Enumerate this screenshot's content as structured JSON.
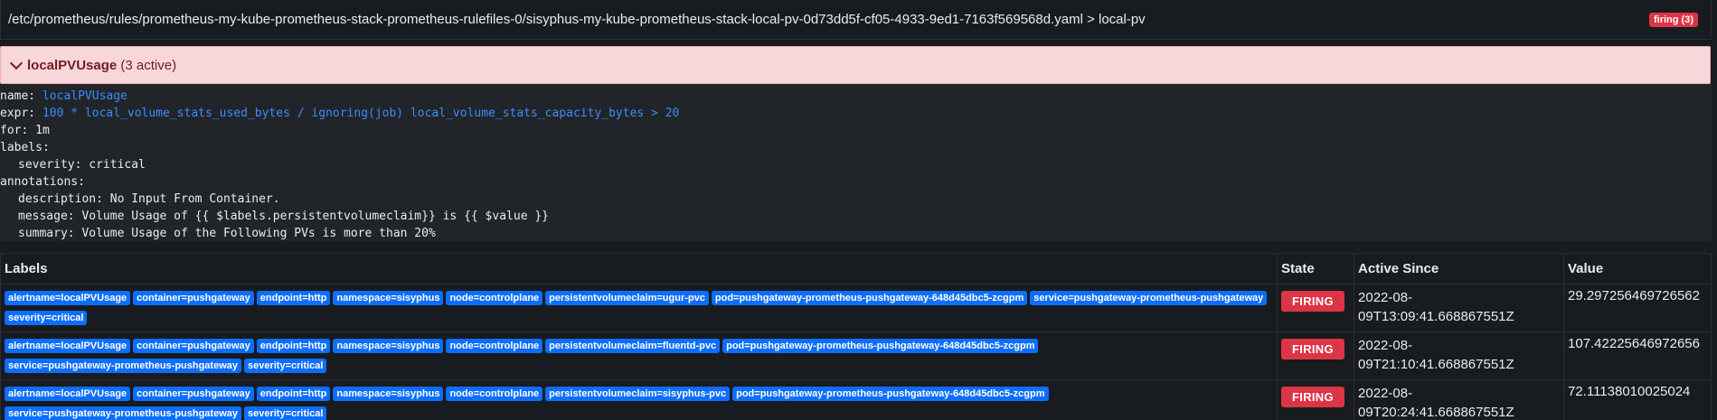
{
  "file": {
    "path": "/etc/prometheus/rules/prometheus-my-kube-prometheus-stack-prometheus-rulefiles-0/sisyphus-my-kube-prometheus-stack-local-pv-0d73dd5f-cf05-4933-9ed1-7163f569568d.yaml > local-pv",
    "badge": "firing (3)"
  },
  "rule": {
    "name": "localPVUsage",
    "active_count": "(3 active)",
    "lines": {
      "name_key": "name: ",
      "name_val": "localPVUsage",
      "expr_key": "expr: ",
      "expr_val": "100 * local_volume_stats_used_bytes / ignoring(job) local_volume_stats_capacity_bytes > 20",
      "for": "for: 1m",
      "labels": "labels:",
      "severity": "severity: critical",
      "annotations": "annotations:",
      "description": "description: No Input From Container.",
      "message": "message: Volume Usage of {{ $labels.persistentvolumeclaim}} is {{ $value }}",
      "summary": "summary: Volume Usage of the Following PVs is more than 20%"
    }
  },
  "table": {
    "headers": {
      "labels": "Labels",
      "state": "State",
      "active_since": "Active Since",
      "value": "Value"
    },
    "rows": [
      {
        "labels": [
          "alertname=localPVUsage",
          "container=pushgateway",
          "endpoint=http",
          "namespace=sisyphus",
          "node=controlplane",
          "persistentvolumeclaim=ugur-pvc",
          "pod=pushgateway-prometheus-pushgateway-648d45dbc5-zcgpm",
          "service=pushgateway-prometheus-pushgateway",
          "severity=critical"
        ],
        "state": "FIRING",
        "active_since": "2022-08-09T13:09:41.668867551Z",
        "value": "29.297256469726562"
      },
      {
        "labels": [
          "alertname=localPVUsage",
          "container=pushgateway",
          "endpoint=http",
          "namespace=sisyphus",
          "node=controlplane",
          "persistentvolumeclaim=fluentd-pvc",
          "pod=pushgateway-prometheus-pushgateway-648d45dbc5-zcgpm",
          "service=pushgateway-prometheus-pushgateway",
          "severity=critical"
        ],
        "state": "FIRING",
        "active_since": "2022-08-09T21:10:41.668867551Z",
        "value": "107.42225646972656"
      },
      {
        "labels": [
          "alertname=localPVUsage",
          "container=pushgateway",
          "endpoint=http",
          "namespace=sisyphus",
          "node=controlplane",
          "persistentvolumeclaim=sisyphus-pvc",
          "pod=pushgateway-prometheus-pushgateway-648d45dbc5-zcgpm",
          "service=pushgateway-prometheus-pushgateway",
          "severity=critical"
        ],
        "state": "FIRING",
        "active_since": "2022-08-09T20:24:41.668867551Z",
        "value": "72.11138010025024"
      }
    ]
  },
  "colors": {
    "firing": "#dc3545",
    "label_badge": "#0d6efd",
    "rule_header_bg": "#f8d7da"
  }
}
